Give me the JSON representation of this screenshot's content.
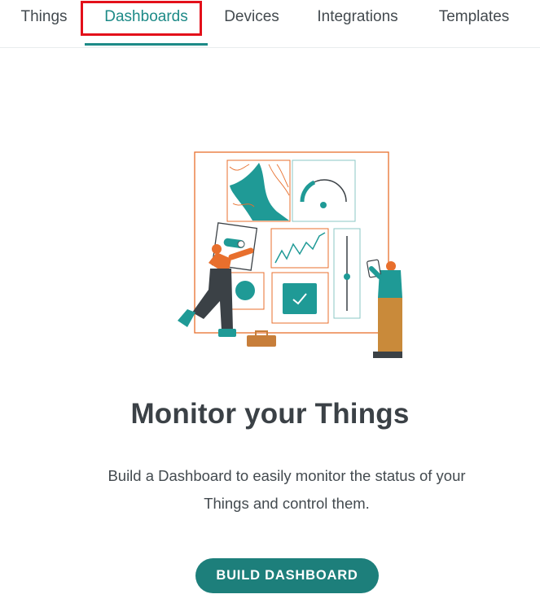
{
  "nav": {
    "tabs": [
      {
        "label": "Things"
      },
      {
        "label": "Dashboards"
      },
      {
        "label": "Devices"
      },
      {
        "label": "Integrations"
      },
      {
        "label": "Templates"
      }
    ],
    "active_tab": "Dashboards"
  },
  "empty_state": {
    "title": "Monitor your Things",
    "description": "Build a Dashboard to easily monitor the status of your Things and control them.",
    "button_label": "BUILD DASHBOARD"
  },
  "colors": {
    "accent": "#1d8a87",
    "button": "#1d7f7b",
    "highlight": "#e3101a",
    "illustration_orange": "#e86f2d",
    "illustration_teal": "#1f9a96"
  }
}
